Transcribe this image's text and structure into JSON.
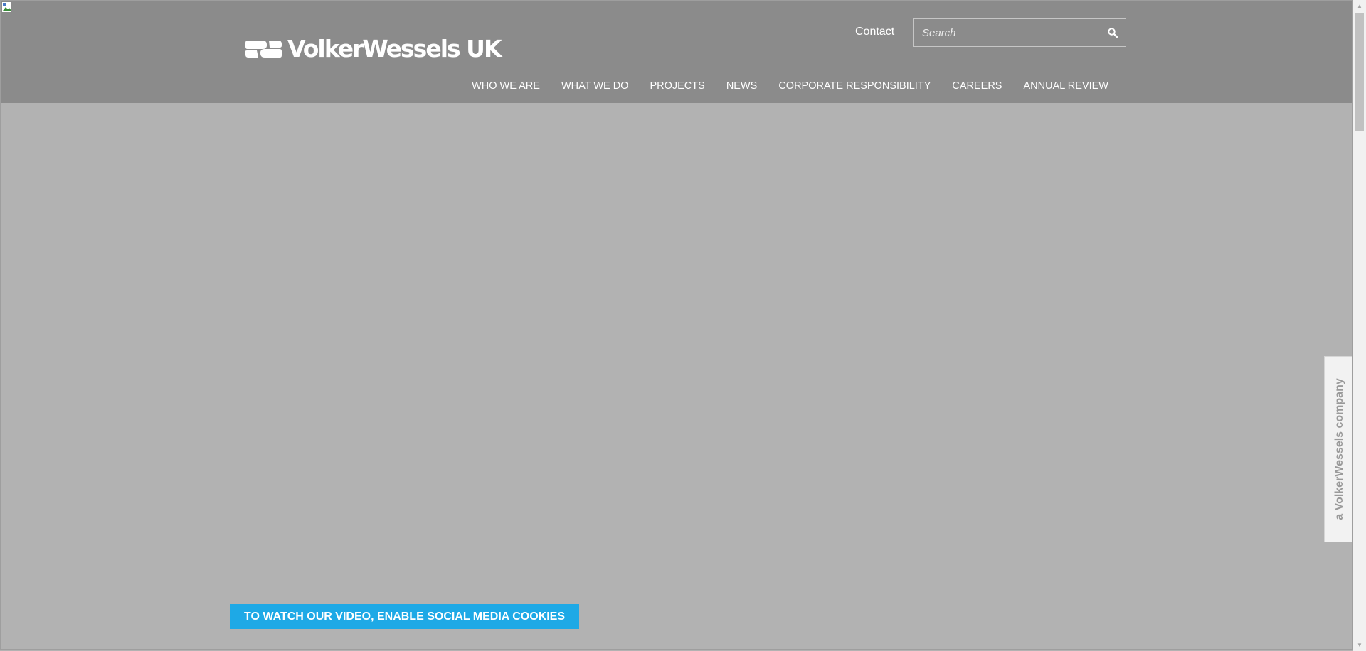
{
  "header": {
    "logo_text": "VolkerWessels UK",
    "contact_label": "Contact",
    "search": {
      "placeholder": "Search",
      "value": ""
    },
    "nav": [
      {
        "label": "WHO WE ARE"
      },
      {
        "label": "WHAT WE DO"
      },
      {
        "label": "PROJECTS"
      },
      {
        "label": "NEWS"
      },
      {
        "label": "CORPORATE RESPONSIBILITY"
      },
      {
        "label": "CAREERS"
      },
      {
        "label": "ANNUAL REVIEW"
      }
    ]
  },
  "hero": {
    "cookie_button_label": "TO WATCH OUR VIDEO, ENABLE SOCIAL MEDIA COOKIES"
  },
  "side_tab": {
    "label": "a VolkerWessels company"
  },
  "colors": {
    "header_bg": "#8b8b8b",
    "hero_bg": "#b2b2b2",
    "accent": "#1ea9e6",
    "text_on_dark": "#ffffff"
  },
  "icons": {
    "search": "magnifier-icon",
    "logo": "volkerwessels-logo-mark",
    "broken_image": "broken-image-icon"
  }
}
